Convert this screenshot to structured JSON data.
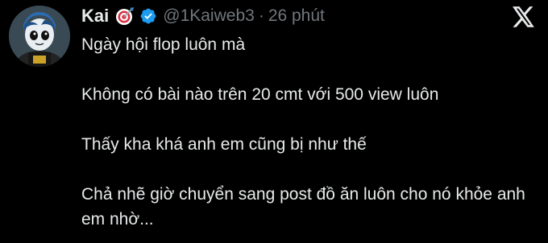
{
  "tweet": {
    "author": {
      "display_name": "Kai",
      "handle": "@1Kaiweb3",
      "name_emoji_icon": "direct-hit-target-emoji",
      "verified_icon": "verified-badge-icon",
      "verified_color": "#1d9bf0"
    },
    "separator": "·",
    "time": "26 phút",
    "paragraphs": [
      "Ngày hội flop luôn mà",
      "Không có bài nào trên 20 cmt với 500 view luôn",
      "Thấy kha khá anh em cũng bị như thế",
      "Chả nhẽ giờ chuyển sang post đồ ăn luôn cho nó khỏe anh em nhờ..."
    ]
  },
  "brand": {
    "logo_icon": "x-logo-icon"
  },
  "colors": {
    "background": "#000000",
    "text": "#e7e9ea",
    "muted": "#71767b"
  }
}
